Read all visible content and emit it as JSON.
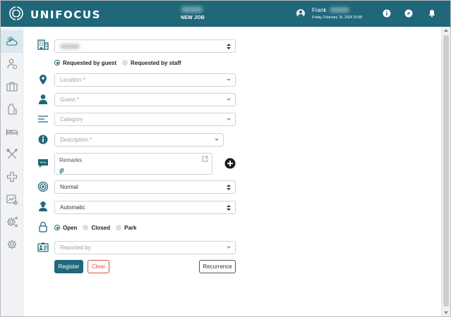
{
  "header": {
    "brand": "UNIFOCUS",
    "job_title": "NEW JOB",
    "user_name": "Frank",
    "datetime": "Friday, February 16, 2024 10:08",
    "icons": [
      "unifocus-logo-icon",
      "user-icon",
      "info-icon",
      "compass-icon",
      "bell-icon"
    ]
  },
  "sidebar": {
    "items": [
      {
        "icon": "weather-icon",
        "active": true
      },
      {
        "icon": "guest-person-icon"
      },
      {
        "icon": "luggage-icon"
      },
      {
        "icon": "housekeeping-icon"
      },
      {
        "icon": "bed-icon"
      },
      {
        "icon": "tools-icon"
      },
      {
        "icon": "plus-medical-icon"
      },
      {
        "icon": "report-icon"
      },
      {
        "icon": "settings-gear-icon"
      },
      {
        "icon": "settings-icon"
      }
    ]
  },
  "form": {
    "requested_by": {
      "options": [
        "Requested by guest",
        "Requested by staff"
      ],
      "selected": "Requested by guest"
    },
    "location": {
      "placeholder": "Location *"
    },
    "guest": {
      "placeholder": "Guest *"
    },
    "category": {
      "placeholder": "Category"
    },
    "description": {
      "placeholder": "Description *"
    },
    "remarks": {
      "placeholder": "Remarks"
    },
    "priority": {
      "value": "Normal"
    },
    "assignment": {
      "value": "Automatic"
    },
    "status": {
      "options": [
        "Open",
        "Closed",
        "Park"
      ],
      "selected": "Open"
    },
    "reported_by": {
      "placeholder": "Reported by"
    }
  },
  "buttons": {
    "register": "Register",
    "clear": "Clear",
    "recurrence": "Recurrence"
  },
  "colors": {
    "brand": "#20677a",
    "danger": "#d9534f",
    "sidebar_bg": "#f1f2f4",
    "active_item_bg": "#dbe9ef"
  }
}
